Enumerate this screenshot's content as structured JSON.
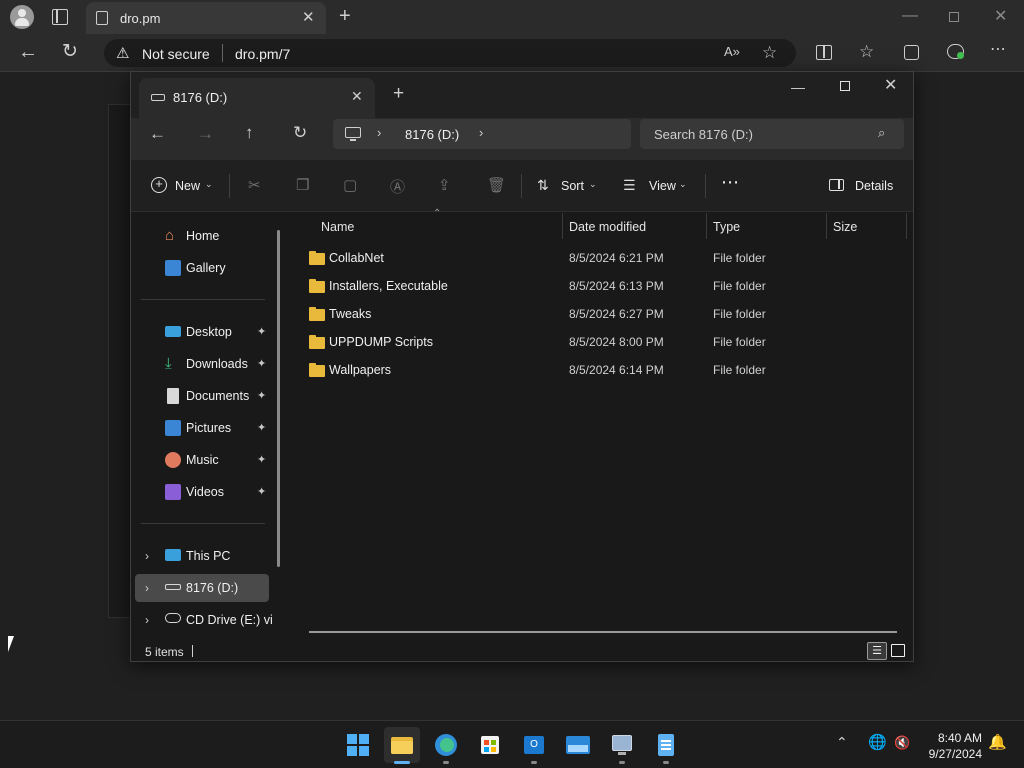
{
  "browser": {
    "tab_title": "dro.pm",
    "security_label": "Not secure",
    "url": "dro.pm/7"
  },
  "explorer": {
    "tab_title": "8176 (D:)",
    "breadcrumb": "8176 (D:)",
    "search_placeholder": "Search 8176 (D:)",
    "commands": {
      "new_label": "New",
      "sort_label": "Sort",
      "view_label": "View",
      "details_label": "Details"
    },
    "sidebar": {
      "home": "Home",
      "gallery": "Gallery",
      "desktop": "Desktop",
      "downloads": "Downloads",
      "documents": "Documents",
      "pictures": "Pictures",
      "music": "Music",
      "videos": "Videos",
      "this_pc": "This PC",
      "drive_d": "8176 (D:)",
      "drive_e": "CD Drive (E:) virt"
    },
    "columns": {
      "name": "Name",
      "date": "Date modified",
      "type": "Type",
      "size": "Size"
    },
    "files": [
      {
        "name": "CollabNet",
        "date": "8/5/2024 6:21 PM",
        "type": "File folder"
      },
      {
        "name": "Installers, Executable",
        "date": "8/5/2024 6:13 PM",
        "type": "File folder"
      },
      {
        "name": "Tweaks",
        "date": "8/5/2024 6:27 PM",
        "type": "File folder"
      },
      {
        "name": "UPPDUMP Scripts",
        "date": "8/5/2024 8:00 PM",
        "type": "File folder"
      },
      {
        "name": "Wallpapers",
        "date": "8/5/2024 6:14 PM",
        "type": "File folder"
      }
    ],
    "status": "5 items"
  },
  "taskbar": {
    "time": "8:40 AM",
    "date": "9/27/2024"
  },
  "colors": {
    "accent": "#5fb2f2",
    "folder": "#e8b93a"
  }
}
